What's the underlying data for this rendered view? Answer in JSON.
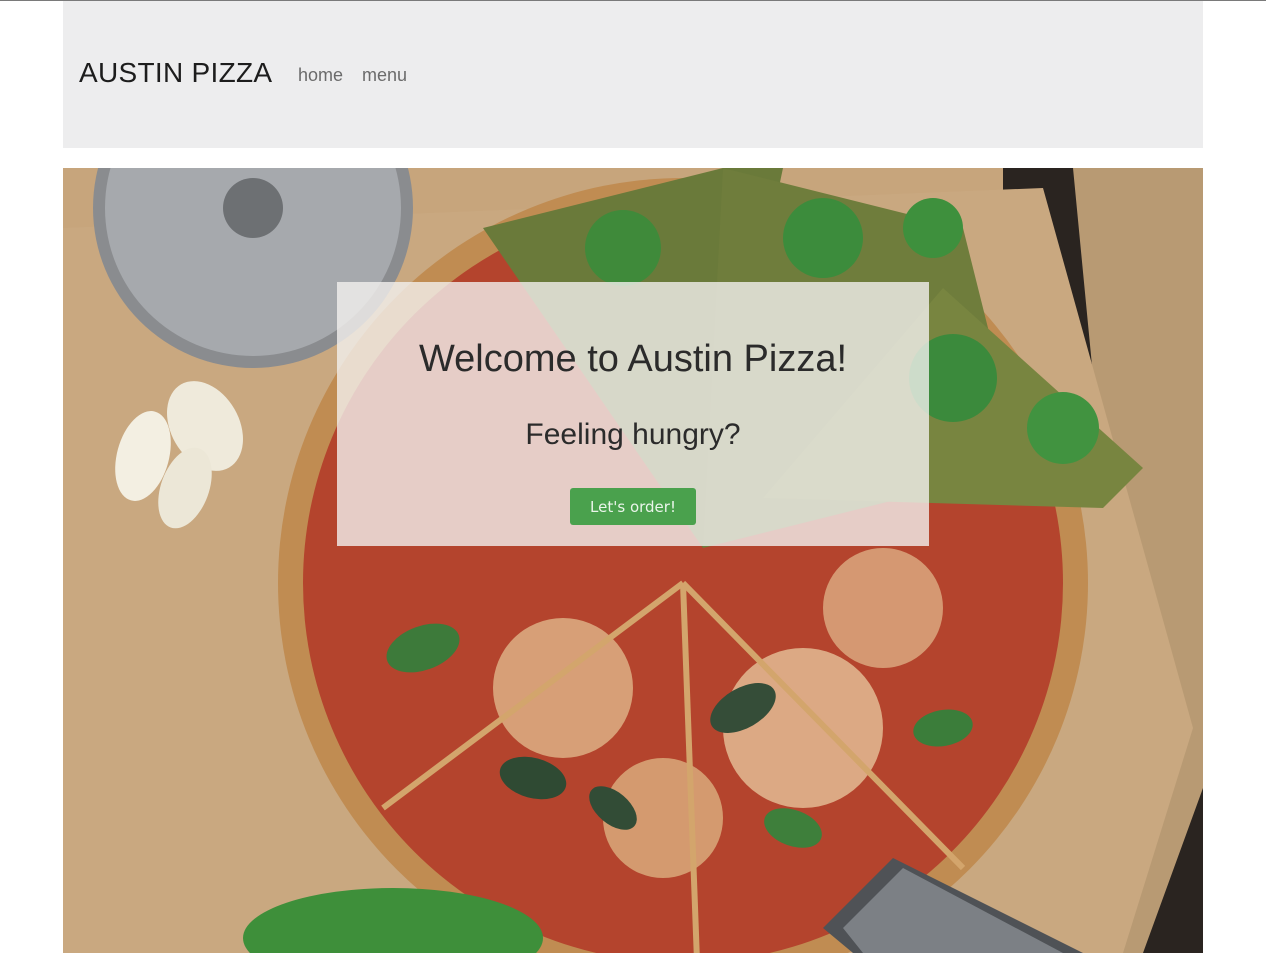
{
  "navbar": {
    "brand": "AUSTIN PIZZA",
    "links": [
      {
        "label": "home"
      },
      {
        "label": "menu"
      }
    ]
  },
  "hero": {
    "heading": "Welcome to Austin Pizza!",
    "subheading": "Feeling hungry?",
    "cta_label": "Let's order!"
  },
  "colors": {
    "navbar_bg": "#ededee",
    "button_bg": "#4aa14d",
    "overlay_bg": "rgba(242,240,238,0.8)"
  }
}
